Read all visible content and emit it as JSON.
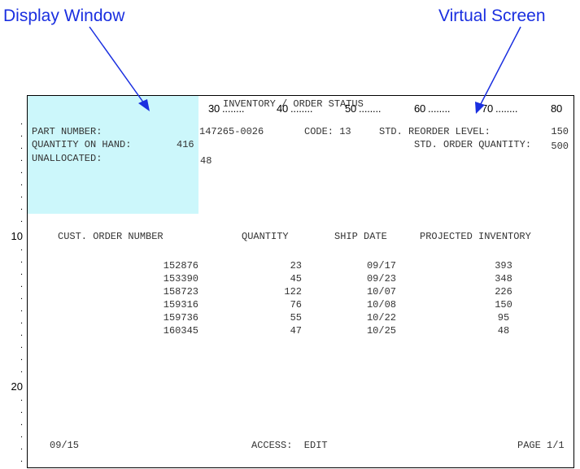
{
  "callouts": {
    "display_window": "Display Window",
    "virtual_screen": "Virtual Screen"
  },
  "ruler": {
    "labels": [
      "10",
      "20",
      "30",
      "40",
      "50",
      "60",
      "70",
      "80"
    ]
  },
  "row_markers": {
    "ten": "10",
    "twenty": "20"
  },
  "screen": {
    "title": "INVENTORY / ORDER STATUS",
    "part_number_label": "PART NUMBER:",
    "part_number_value": "147265-0026",
    "code_label": "CODE: 13",
    "reorder_label": "STD. REORDER LEVEL:",
    "reorder_value": "150",
    "qoh_label": "QUANTITY ON HAND:",
    "qoh_value": "416",
    "order_qty_label": "STD. ORDER QUANTITY:",
    "order_qty_value": "500",
    "unallocated_label": "UNALLOCATED:",
    "unallocated_value": "48",
    "columns": [
      "CUST. ORDER NUMBER",
      "QUANTITY",
      "SHIP DATE",
      "PROJECTED INVENTORY"
    ],
    "rows": [
      {
        "order": "152876",
        "qty": "23",
        "ship": "09/17",
        "proj": "393"
      },
      {
        "order": "153390",
        "qty": "45",
        "ship": "09/23",
        "proj": "348"
      },
      {
        "order": "158723",
        "qty": "122",
        "ship": "10/07",
        "proj": "226"
      },
      {
        "order": "159316",
        "qty": "76",
        "ship": "10/08",
        "proj": "150"
      },
      {
        "order": "159736",
        "qty": "55",
        "ship": "10/22",
        "proj": "95"
      },
      {
        "order": "160345",
        "qty": "47",
        "ship": "10/25",
        "proj": "48"
      }
    ],
    "footer_date": "09/15",
    "footer_access": "ACCESS:  EDIT",
    "footer_page": "PAGE 1/1"
  },
  "colors": {
    "callout": "#1a2fe0",
    "display_window": "#ccf7fb"
  }
}
